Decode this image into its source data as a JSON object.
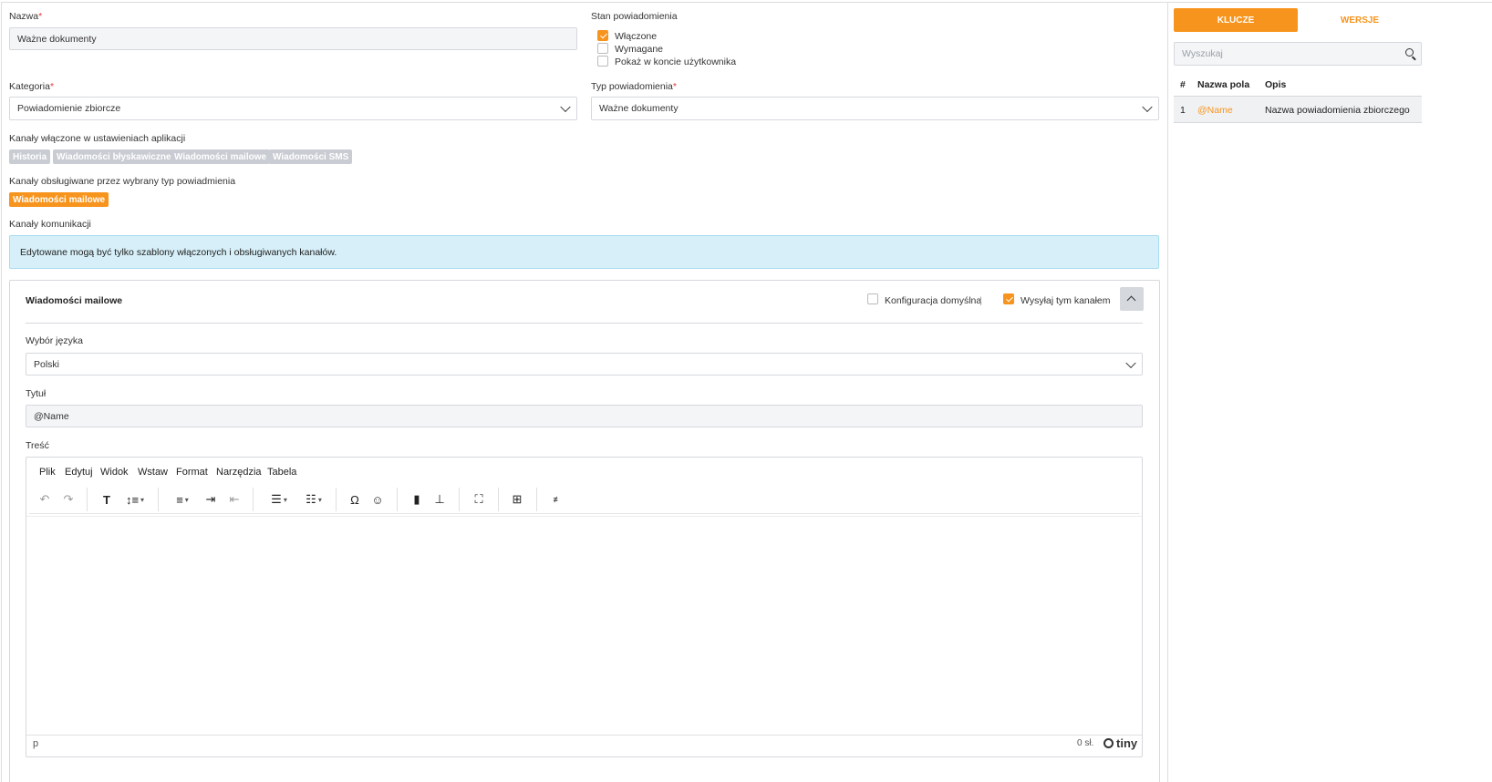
{
  "form": {
    "name_label": "Nazwa",
    "name_value": "Ważne dokumenty",
    "status_label": "Stan powiadomienia",
    "status_options": [
      {
        "label": "Włączone",
        "checked": true
      },
      {
        "label": "Wymagane",
        "checked": false
      },
      {
        "label": "Pokaż w koncie użytkownika",
        "checked": false
      }
    ],
    "category_label": "Kategoria",
    "category_value": "Powiadomienie zbiorcze",
    "type_label": "Typ powiadomienia",
    "type_value": "Ważne dokumenty",
    "required_mark": "*",
    "enabled_channels_label": "Kanały włączone w ustawieniach aplikacji",
    "enabled_channels": [
      "Historia",
      "Wiadomości błyskawiczne",
      "Wiadomości mailowe",
      "Wiadomości SMS"
    ],
    "supported_channels_label": "Kanały obsługiwane przez wybrany typ powiadmienia",
    "supported_channels": [
      "Wiadomości mailowe"
    ],
    "comm_channels_label": "Kanały komunikacji",
    "info_text": "Edytowane mogą być tylko szablony włączonych i obsługiwanych kanałów."
  },
  "channel_panel": {
    "title": "Wiadomości mailowe",
    "default_config_label": "Konfiguracja domyślna",
    "default_config_checked": false,
    "divider": "|",
    "send_label": "Wysyłaj tym kanałem",
    "send_checked": true,
    "language_label": "Wybór języka",
    "language_value": "Polski",
    "title_label": "Tytuł",
    "title_value": "@Name",
    "content_label": "Treść"
  },
  "editor": {
    "menu": [
      "Plik",
      "Edytuj",
      "Widok",
      "Wstaw",
      "Format",
      "Narzędzia",
      "Tabela"
    ],
    "status_path": "p",
    "word_count": "0 sł.",
    "brand": "tiny"
  },
  "sidebar": {
    "tab_keys": "KLUCZE",
    "tab_versions": "WERSJE",
    "search_placeholder": "Wyszukaj",
    "columns": [
      "#",
      "Nazwa pola",
      "Opis"
    ],
    "rows": [
      {
        "num": "1",
        "field": "@Name",
        "desc": "Nazwa powiadomienia zbiorczego"
      }
    ]
  },
  "colors": {
    "accent": "#f7941d",
    "info_bg": "#d6eff8",
    "tag_gray": "#c9ccd2"
  }
}
